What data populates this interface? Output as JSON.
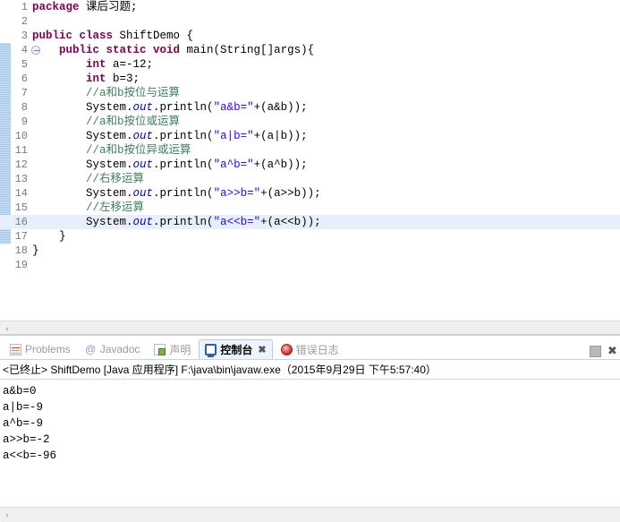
{
  "editor": {
    "name": "java-editor",
    "lines": [
      {
        "num": "1",
        "indent": 0,
        "tokens": [
          {
            "t": "kw",
            "v": "package"
          },
          {
            "t": "pln",
            "v": " 课后习题;"
          }
        ]
      },
      {
        "num": "2",
        "indent": 0,
        "tokens": []
      },
      {
        "num": "3",
        "indent": 0,
        "tokens": [
          {
            "t": "kw",
            "v": "public class"
          },
          {
            "t": "pln",
            "v": " ShiftDemo {"
          }
        ]
      },
      {
        "num": "4",
        "indent": 0,
        "fold": true,
        "tokens": [
          {
            "t": "pln",
            "v": "    "
          },
          {
            "t": "kw",
            "v": "public static void"
          },
          {
            "t": "pln",
            "v": " main(String[]args){"
          }
        ]
      },
      {
        "num": "5",
        "indent": 0,
        "tokens": [
          {
            "t": "pln",
            "v": "        "
          },
          {
            "t": "kw",
            "v": "int"
          },
          {
            "t": "pln",
            "v": " a=-12;"
          }
        ]
      },
      {
        "num": "6",
        "indent": 0,
        "tokens": [
          {
            "t": "pln",
            "v": "        "
          },
          {
            "t": "kw",
            "v": "int"
          },
          {
            "t": "pln",
            "v": " b=3;"
          }
        ]
      },
      {
        "num": "7",
        "indent": 0,
        "tokens": [
          {
            "t": "cmt",
            "v": "        //a和b按位与运算"
          }
        ]
      },
      {
        "num": "8",
        "indent": 0,
        "tokens": [
          {
            "t": "pln",
            "v": "        System."
          },
          {
            "t": "fld",
            "v": "out"
          },
          {
            "t": "pln",
            "v": ".println("
          },
          {
            "t": "str",
            "v": "\"a&b=\""
          },
          {
            "t": "pln",
            "v": "+(a&b));"
          }
        ]
      },
      {
        "num": "9",
        "indent": 0,
        "tokens": [
          {
            "t": "cmt",
            "v": "        //a和b按位或运算"
          }
        ]
      },
      {
        "num": "10",
        "indent": 0,
        "tokens": [
          {
            "t": "pln",
            "v": "        System."
          },
          {
            "t": "fld",
            "v": "out"
          },
          {
            "t": "pln",
            "v": ".println("
          },
          {
            "t": "str",
            "v": "\"a|b=\""
          },
          {
            "t": "pln",
            "v": "+(a|b));"
          }
        ]
      },
      {
        "num": "11",
        "indent": 0,
        "tokens": [
          {
            "t": "cmt",
            "v": "        //a和b按位异或运算"
          }
        ]
      },
      {
        "num": "12",
        "indent": 0,
        "tokens": [
          {
            "t": "pln",
            "v": "        System."
          },
          {
            "t": "fld",
            "v": "out"
          },
          {
            "t": "pln",
            "v": ".println("
          },
          {
            "t": "str",
            "v": "\"a^b=\""
          },
          {
            "t": "pln",
            "v": "+(a^b));"
          }
        ]
      },
      {
        "num": "13",
        "indent": 0,
        "tokens": [
          {
            "t": "cmt",
            "v": "        //右移运算"
          }
        ]
      },
      {
        "num": "14",
        "indent": 0,
        "tokens": [
          {
            "t": "pln",
            "v": "        System."
          },
          {
            "t": "fld",
            "v": "out"
          },
          {
            "t": "pln",
            "v": ".println("
          },
          {
            "t": "str",
            "v": "\"a>>b=\""
          },
          {
            "t": "pln",
            "v": "+(a>>b));"
          }
        ]
      },
      {
        "num": "15",
        "indent": 0,
        "tokens": [
          {
            "t": "cmt",
            "v": "        //左移运算"
          }
        ]
      },
      {
        "num": "16",
        "indent": 0,
        "highlight": true,
        "tokens": [
          {
            "t": "pln",
            "v": "        System."
          },
          {
            "t": "fld",
            "v": "out"
          },
          {
            "t": "pln",
            "v": ".println("
          },
          {
            "t": "str",
            "v": "\"a<<b=\""
          },
          {
            "t": "pln",
            "v": "+(a<<b));"
          }
        ]
      },
      {
        "num": "17",
        "indent": 0,
        "tokens": [
          {
            "t": "pln",
            "v": "    }"
          }
        ]
      },
      {
        "num": "18",
        "indent": 0,
        "tokens": [
          {
            "t": "pln",
            "v": "}"
          }
        ]
      },
      {
        "num": "19",
        "indent": 0,
        "tokens": []
      }
    ],
    "scroll_left_arrow": "‹"
  },
  "console_view": {
    "tabs": [
      {
        "label": "Problems",
        "icon": "problems-icon",
        "active": false,
        "closable": false
      },
      {
        "label": "Javadoc",
        "icon": "javadoc-icon",
        "active": false,
        "closable": false
      },
      {
        "label": "声明",
        "icon": "declaration-icon",
        "active": false,
        "closable": false
      },
      {
        "label": "控制台",
        "icon": "console-icon",
        "active": true,
        "closable": true,
        "close_label": "✖"
      },
      {
        "label": "错误日志",
        "icon": "error-log-icon",
        "active": false,
        "closable": false
      }
    ],
    "tools": [
      {
        "name": "stop-button",
        "label": ""
      },
      {
        "name": "close-view-button",
        "label": "✖"
      }
    ],
    "status_line": "<已终止> ShiftDemo [Java 应用程序] F:\\java\\bin\\javaw.exe（2015年9月29日 下午5:57:40）",
    "output": [
      "a&b=0",
      "a|b=-9",
      "a^b=-9",
      "a>>b=-2",
      "a<<b=-96"
    ],
    "scroll_left_arrow": "‹"
  },
  "colors": {
    "keyword": "#7f0055",
    "string": "#2a00ff",
    "comment": "#3f7f5f",
    "field": "#0000c0",
    "line_highlight": "#e8eefc",
    "gutter_text": "#7a7a7a",
    "tab_active_bg": "#eef4fb"
  }
}
